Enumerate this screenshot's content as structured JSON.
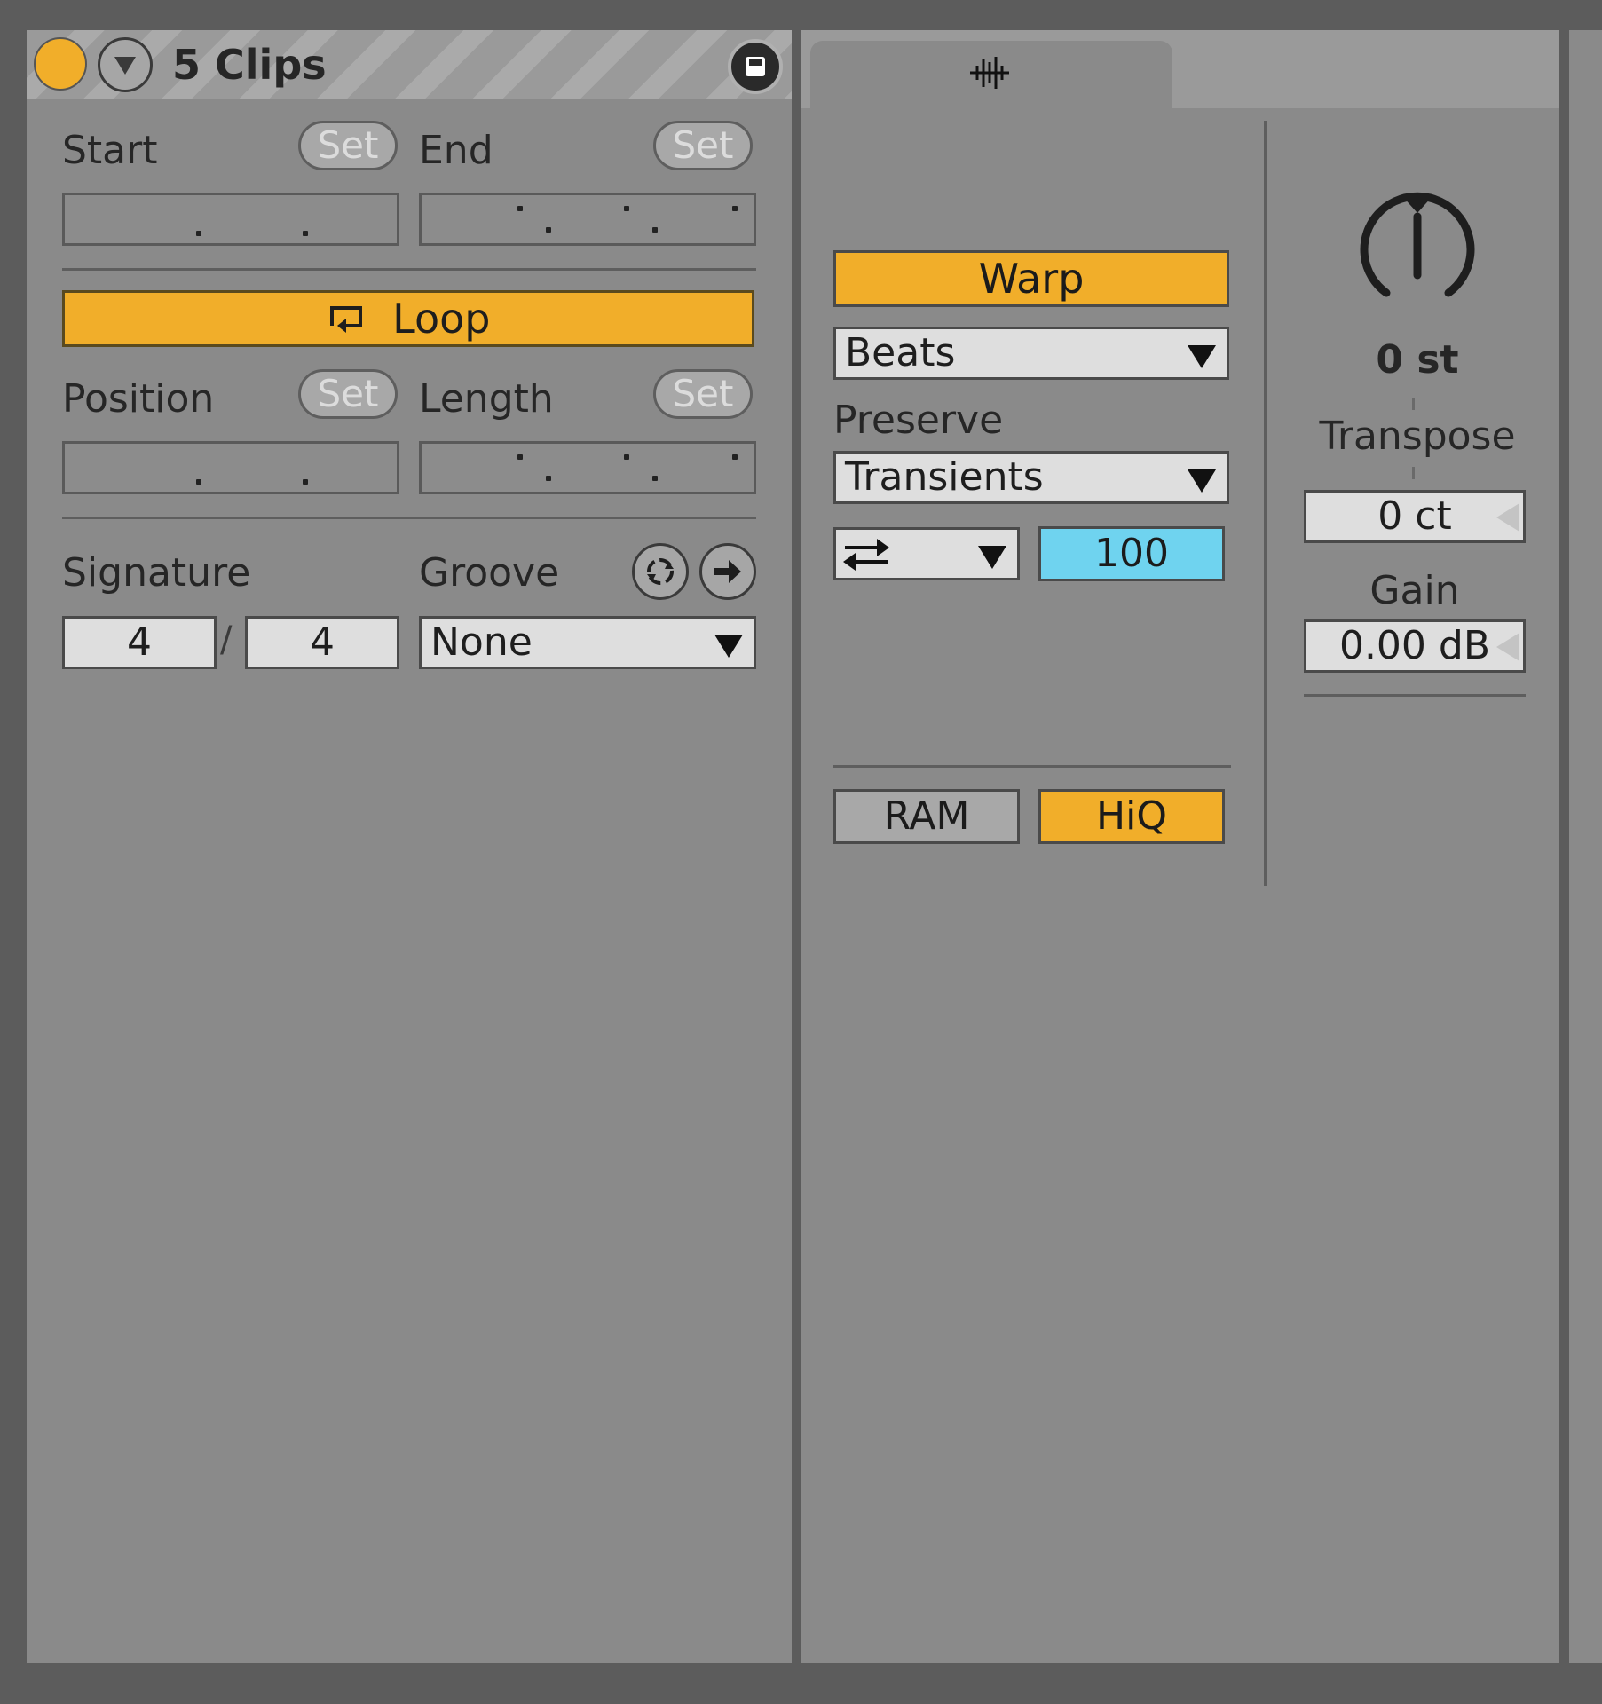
{
  "clip": {
    "title": "5 Clips",
    "color": "#f1ae2a",
    "start_label": "Start",
    "end_label": "End",
    "set_label": "Set",
    "loop_label": "Loop",
    "position_label": "Position",
    "length_label": "Length",
    "signature_label": "Signature",
    "groove_label": "Groove",
    "signature_numerator": "4",
    "signature_separator": "/",
    "signature_denominator": "4",
    "groove_value": "None"
  },
  "sample": {
    "tab_icon": "waveform-icon",
    "warp_label": "Warp",
    "warp_mode": "Beats",
    "preserve_label": "Preserve",
    "preserve_value": "Transients",
    "loop_mode_icon": "swap-arrows-icon",
    "envelope_value": "100",
    "ram_label": "RAM",
    "hiq_label": "HiQ",
    "transpose_value": "0 st",
    "transpose_label": "Transpose",
    "detune_value": "0 ct",
    "gain_label": "Gain",
    "gain_value": "0.00 dB"
  },
  "colors": {
    "accent": "#f1ae2a",
    "envelope_highlight": "#6fd3ef",
    "panel": "#8a8a8a",
    "frame": "#5c5c5c"
  }
}
